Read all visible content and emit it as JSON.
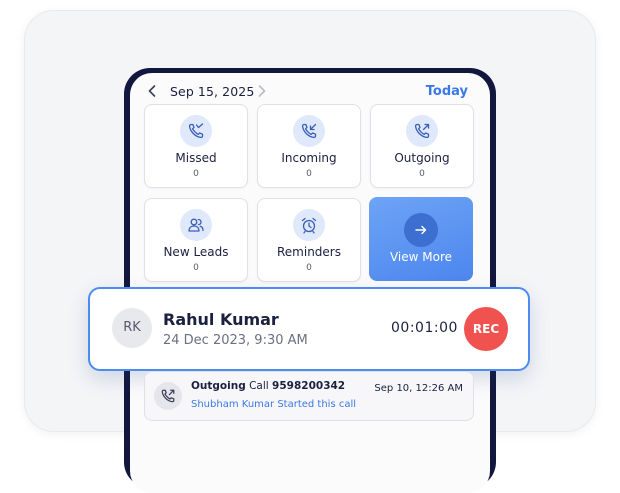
{
  "header": {
    "date": "Sep 15, 2025",
    "today_label": "Today"
  },
  "tiles": [
    {
      "label": "Missed",
      "count": "0",
      "icon": "missed-call-icon"
    },
    {
      "label": "Incoming",
      "count": "0",
      "icon": "incoming-call-icon"
    },
    {
      "label": "Outgoing",
      "count": "0",
      "icon": "outgoing-call-icon"
    },
    {
      "label": "New Leads",
      "count": "0",
      "icon": "users-icon"
    },
    {
      "label": "Reminders",
      "count": "0",
      "icon": "alarm-clock-icon"
    }
  ],
  "view_more": {
    "label": "View More",
    "icon": "arrow-right-icon"
  },
  "active_call": {
    "initials": "RK",
    "name": "Rahul Kumar",
    "datetime": "24 Dec 2023, 9:30 AM",
    "timer": "00:01:00",
    "rec_label": "REC"
  },
  "call_log": {
    "type": "Outgoing",
    "call_word": "Call",
    "number": "9598200342",
    "subtitle": "Shubham Kumar Started this call",
    "time": "Sep 10, 12:26 AM",
    "icon": "outgoing-call-icon"
  },
  "colors": {
    "accent": "#3b78e7",
    "rec": "#f0524f",
    "phone_frame": "#12173d",
    "highlight_border": "#4c8bf0"
  }
}
